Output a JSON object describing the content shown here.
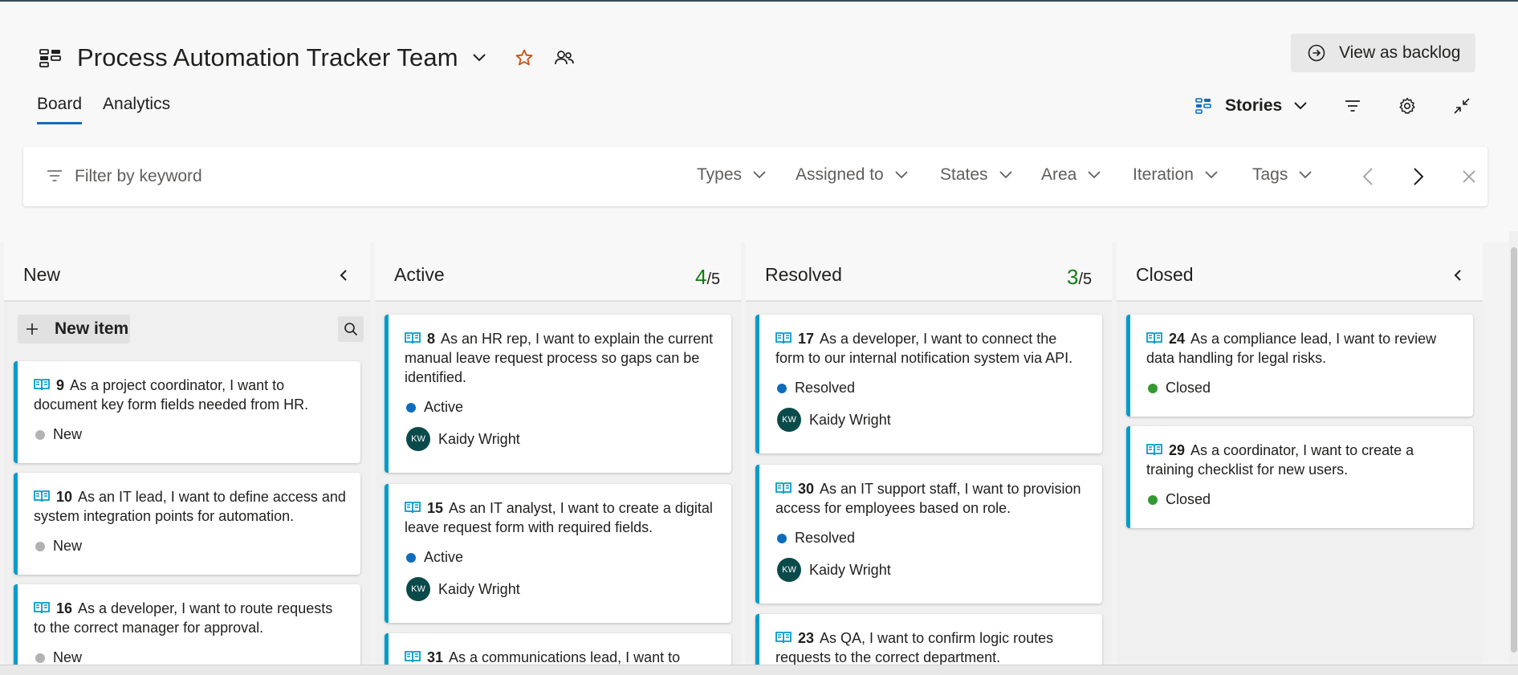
{
  "header": {
    "title": "Process Automation Tracker Team",
    "backlog_button": "View as backlog"
  },
  "tabs": [
    {
      "label": "Board",
      "active": true
    },
    {
      "label": "Analytics",
      "active": false
    }
  ],
  "tools": {
    "level": "Stories"
  },
  "filter": {
    "placeholder": "Filter by keyword",
    "dropdowns": [
      "Types",
      "Assigned to",
      "States",
      "Area",
      "Iteration",
      "Tags"
    ]
  },
  "columns": [
    {
      "name": "New",
      "new_item_label": "New item",
      "cards": [
        {
          "id": "9",
          "text": "As a project coordinator, I want to document key form fields needed from HR.",
          "state": "New"
        },
        {
          "id": "10",
          "text": "As an IT lead, I want to define access and system integration points for automation.",
          "state": "New"
        },
        {
          "id": "16",
          "text": "As a developer, I want to route requests to the correct manager for approval.",
          "state": "New"
        }
      ]
    },
    {
      "name": "Active",
      "count": "4",
      "limit": "/5",
      "cards": [
        {
          "id": "8",
          "text": "As an HR rep, I want to explain the current manual leave request process so gaps can be identified.",
          "state": "Active",
          "assignee": "Kaidy Wright",
          "initials": "KW"
        },
        {
          "id": "15",
          "text": "As an IT analyst, I want to create a digital leave request form with required fields.",
          "state": "Active",
          "assignee": "Kaidy Wright",
          "initials": "KW"
        },
        {
          "id": "31",
          "text": "As a communications lead, I want to"
        }
      ]
    },
    {
      "name": "Resolved",
      "count": "3",
      "limit": "/5",
      "cards": [
        {
          "id": "17",
          "text": "As a developer, I want to connect the form to our internal notification system via API.",
          "state": "Resolved",
          "assignee": "Kaidy Wright",
          "initials": "KW"
        },
        {
          "id": "30",
          "text": "As an IT support staff, I want to provision access for employees based on role.",
          "state": "Resolved",
          "assignee": "Kaidy Wright",
          "initials": "KW"
        },
        {
          "id": "23",
          "text": "As QA, I want to confirm logic routes requests to the correct department."
        }
      ]
    },
    {
      "name": "Closed",
      "cards": [
        {
          "id": "24",
          "text": "As a compliance lead, I want to review data handling for legal risks.",
          "state": "Closed"
        },
        {
          "id": "29",
          "text": "As a coordinator, I want to create a training checklist for new users.",
          "state": "Closed"
        }
      ]
    }
  ],
  "colors": {
    "accent": "#0f6cbd",
    "story_bar": "#009ccc",
    "state_new": "#b2b2b2",
    "state_active": "#0f6cbd",
    "state_resolved": "#0f6cbd",
    "state_closed": "#339933",
    "count_green": "#107c10"
  }
}
